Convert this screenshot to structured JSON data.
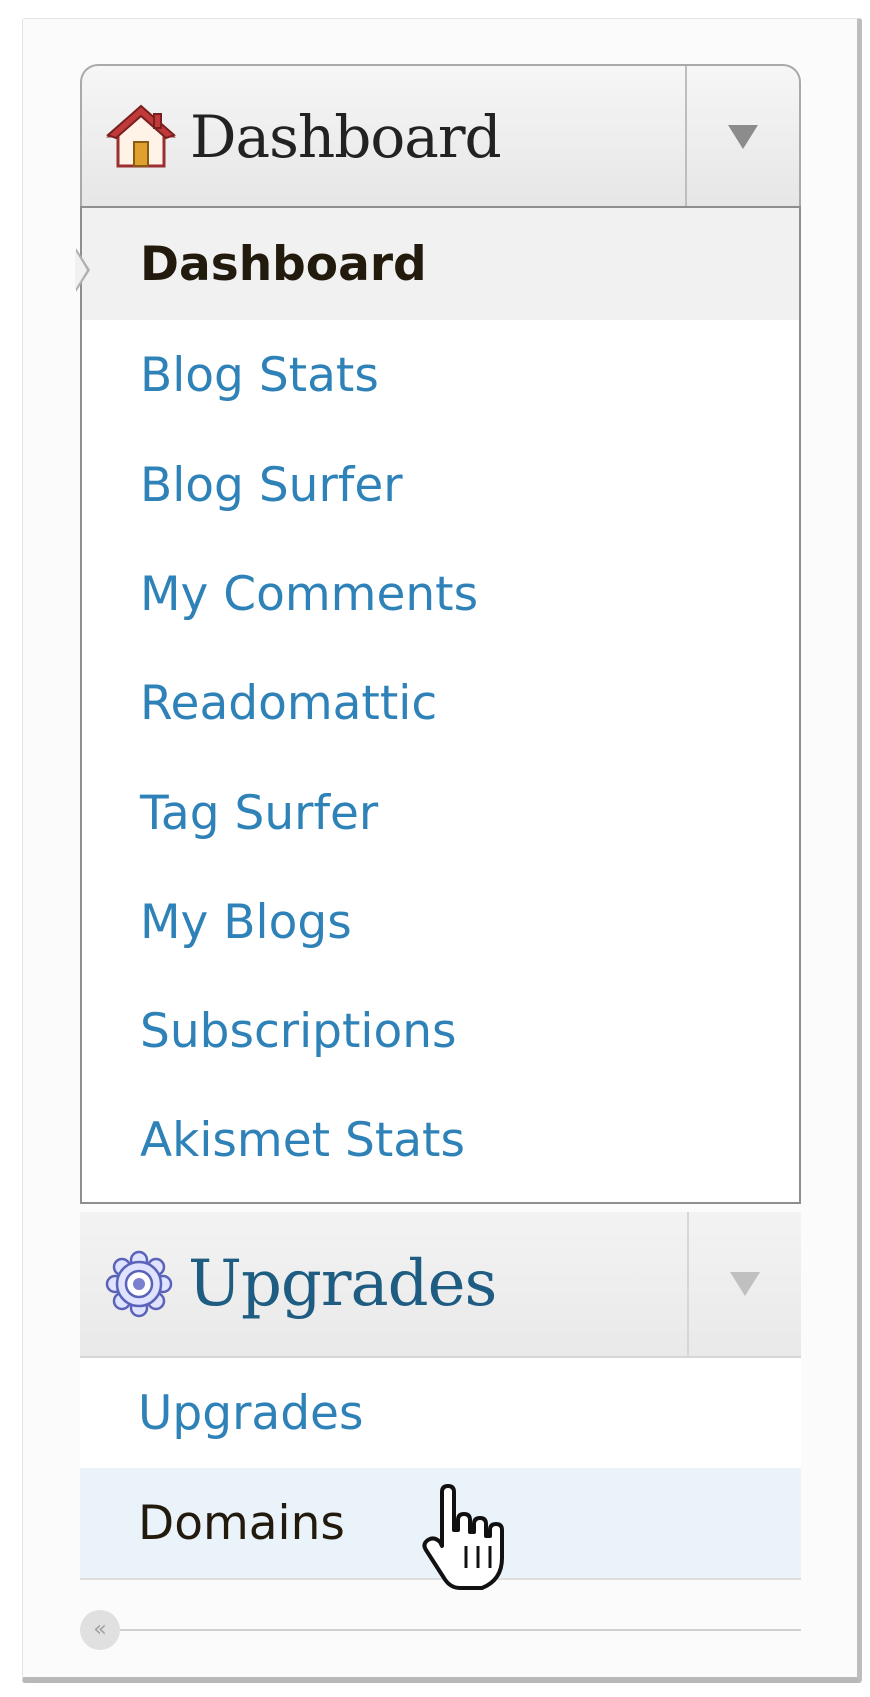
{
  "dashboard": {
    "header_label": "Dashboard",
    "icon": "house-icon",
    "toggle_icon": "triangle-down-icon",
    "items": [
      {
        "label": "Dashboard",
        "current": true
      },
      {
        "label": "Blog Stats"
      },
      {
        "label": "Blog Surfer"
      },
      {
        "label": "My Comments"
      },
      {
        "label": "Readomattic"
      },
      {
        "label": "Tag Surfer"
      },
      {
        "label": "My Blogs"
      },
      {
        "label": "Subscriptions"
      },
      {
        "label": "Akismet Stats"
      }
    ]
  },
  "upgrades": {
    "header_label": "Upgrades",
    "icon": "gear-icon",
    "toggle_icon": "triangle-down-icon",
    "items": [
      {
        "label": "Upgrades"
      },
      {
        "label": "Domains",
        "hovered": true
      }
    ]
  },
  "collapse": {
    "label": "«",
    "icon": "collapse-menu-icon"
  },
  "cursor": {
    "icon": "hand-pointer-icon"
  },
  "colors": {
    "link": "#2e82b8",
    "current_text": "#231a0e",
    "hover_bg": "#eaf2fa",
    "header_upgrades": "#1e5c82"
  }
}
